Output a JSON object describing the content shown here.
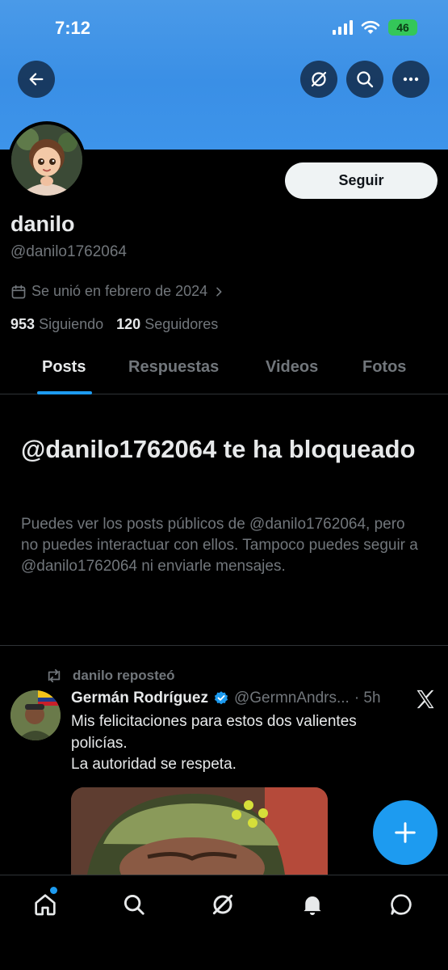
{
  "status_bar": {
    "time": "7:12",
    "battery": "46"
  },
  "top_actions": {
    "back": "back-arrow-icon",
    "grok": "grok-icon",
    "search": "search-icon",
    "more": "more-icon"
  },
  "profile": {
    "display_name": "danilo",
    "handle": "@danilo1762064",
    "follow_label": "Seguir",
    "joined": "Se unió en febrero de 2024",
    "following_count": "953",
    "following_label": "Siguiendo",
    "followers_count": "120",
    "followers_label": "Seguidores"
  },
  "tabs": [
    {
      "label": "Posts",
      "active": true
    },
    {
      "label": "Respuestas",
      "active": false
    },
    {
      "label": "Videos",
      "active": false
    },
    {
      "label": "Fotos",
      "active": false
    }
  ],
  "blocked": {
    "title": "@danilo1762064 te ha bloqueado",
    "description": "Puedes ver los posts públicos de @danilo1762064, pero no puedes interactuar con ellos. Tampoco puedes seguir a @danilo1762064 ni enviarle mensajes."
  },
  "post": {
    "repost_label": "danilo reposteó",
    "author": "Germán Rodríguez",
    "handle": "@GermnAndrs...",
    "time": "· 5h",
    "text_line1": "Mis felicitaciones para estos dos valientes policías.",
    "text_line2": "La autoridad se respeta."
  },
  "bottom_nav": [
    "home-icon",
    "search-icon",
    "grok-icon",
    "notifications-icon",
    "messages-icon"
  ],
  "colors": {
    "accent": "#1d9bf0",
    "banner": "#3a8fe6",
    "background": "#000000",
    "muted": "#71767b"
  }
}
